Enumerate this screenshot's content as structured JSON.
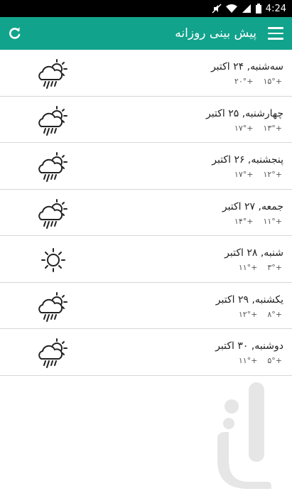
{
  "status_bar": {
    "time": "4:24"
  },
  "app_bar": {
    "title": "پیش بینی روزانه",
    "menu_icon": "hamburger-menu-icon",
    "refresh_icon": "refresh-icon",
    "background": "#12a38c"
  },
  "forecast": [
    {
      "day": "سه‌شنبه, ۲۴ اکتبر",
      "low": "+۱۵°",
      "high": "+۲۰°",
      "icon": "rain-cloud-sun-icon"
    },
    {
      "day": "چهارشنبه, ۲۵ اکتبر",
      "low": "+۱۳°",
      "high": "+۱۷°",
      "icon": "rain-cloud-sun-icon"
    },
    {
      "day": "پنجشنبه, ۲۶ اکتبر",
      "low": "+۱۲°",
      "high": "+۱۷°",
      "icon": "rain-cloud-sun-icon"
    },
    {
      "day": "جمعه, ۲۷ اکتبر",
      "low": "+۱۱°",
      "high": "+۱۴°",
      "icon": "rain-cloud-sun-icon"
    },
    {
      "day": "شنبه, ۲۸ اکتبر",
      "low": "+۳°",
      "high": "+۱۱°",
      "icon": "sun-icon"
    },
    {
      "day": "یکشنبه, ۲۹ اکتبر",
      "low": "+۸°",
      "high": "+۱۲°",
      "icon": "rain-cloud-sun-icon"
    },
    {
      "day": "دوشنبه, ۳۰ اکتبر",
      "low": "+۵°",
      "high": "+۱۱°",
      "icon": "rain-cloud-sun-icon"
    }
  ]
}
